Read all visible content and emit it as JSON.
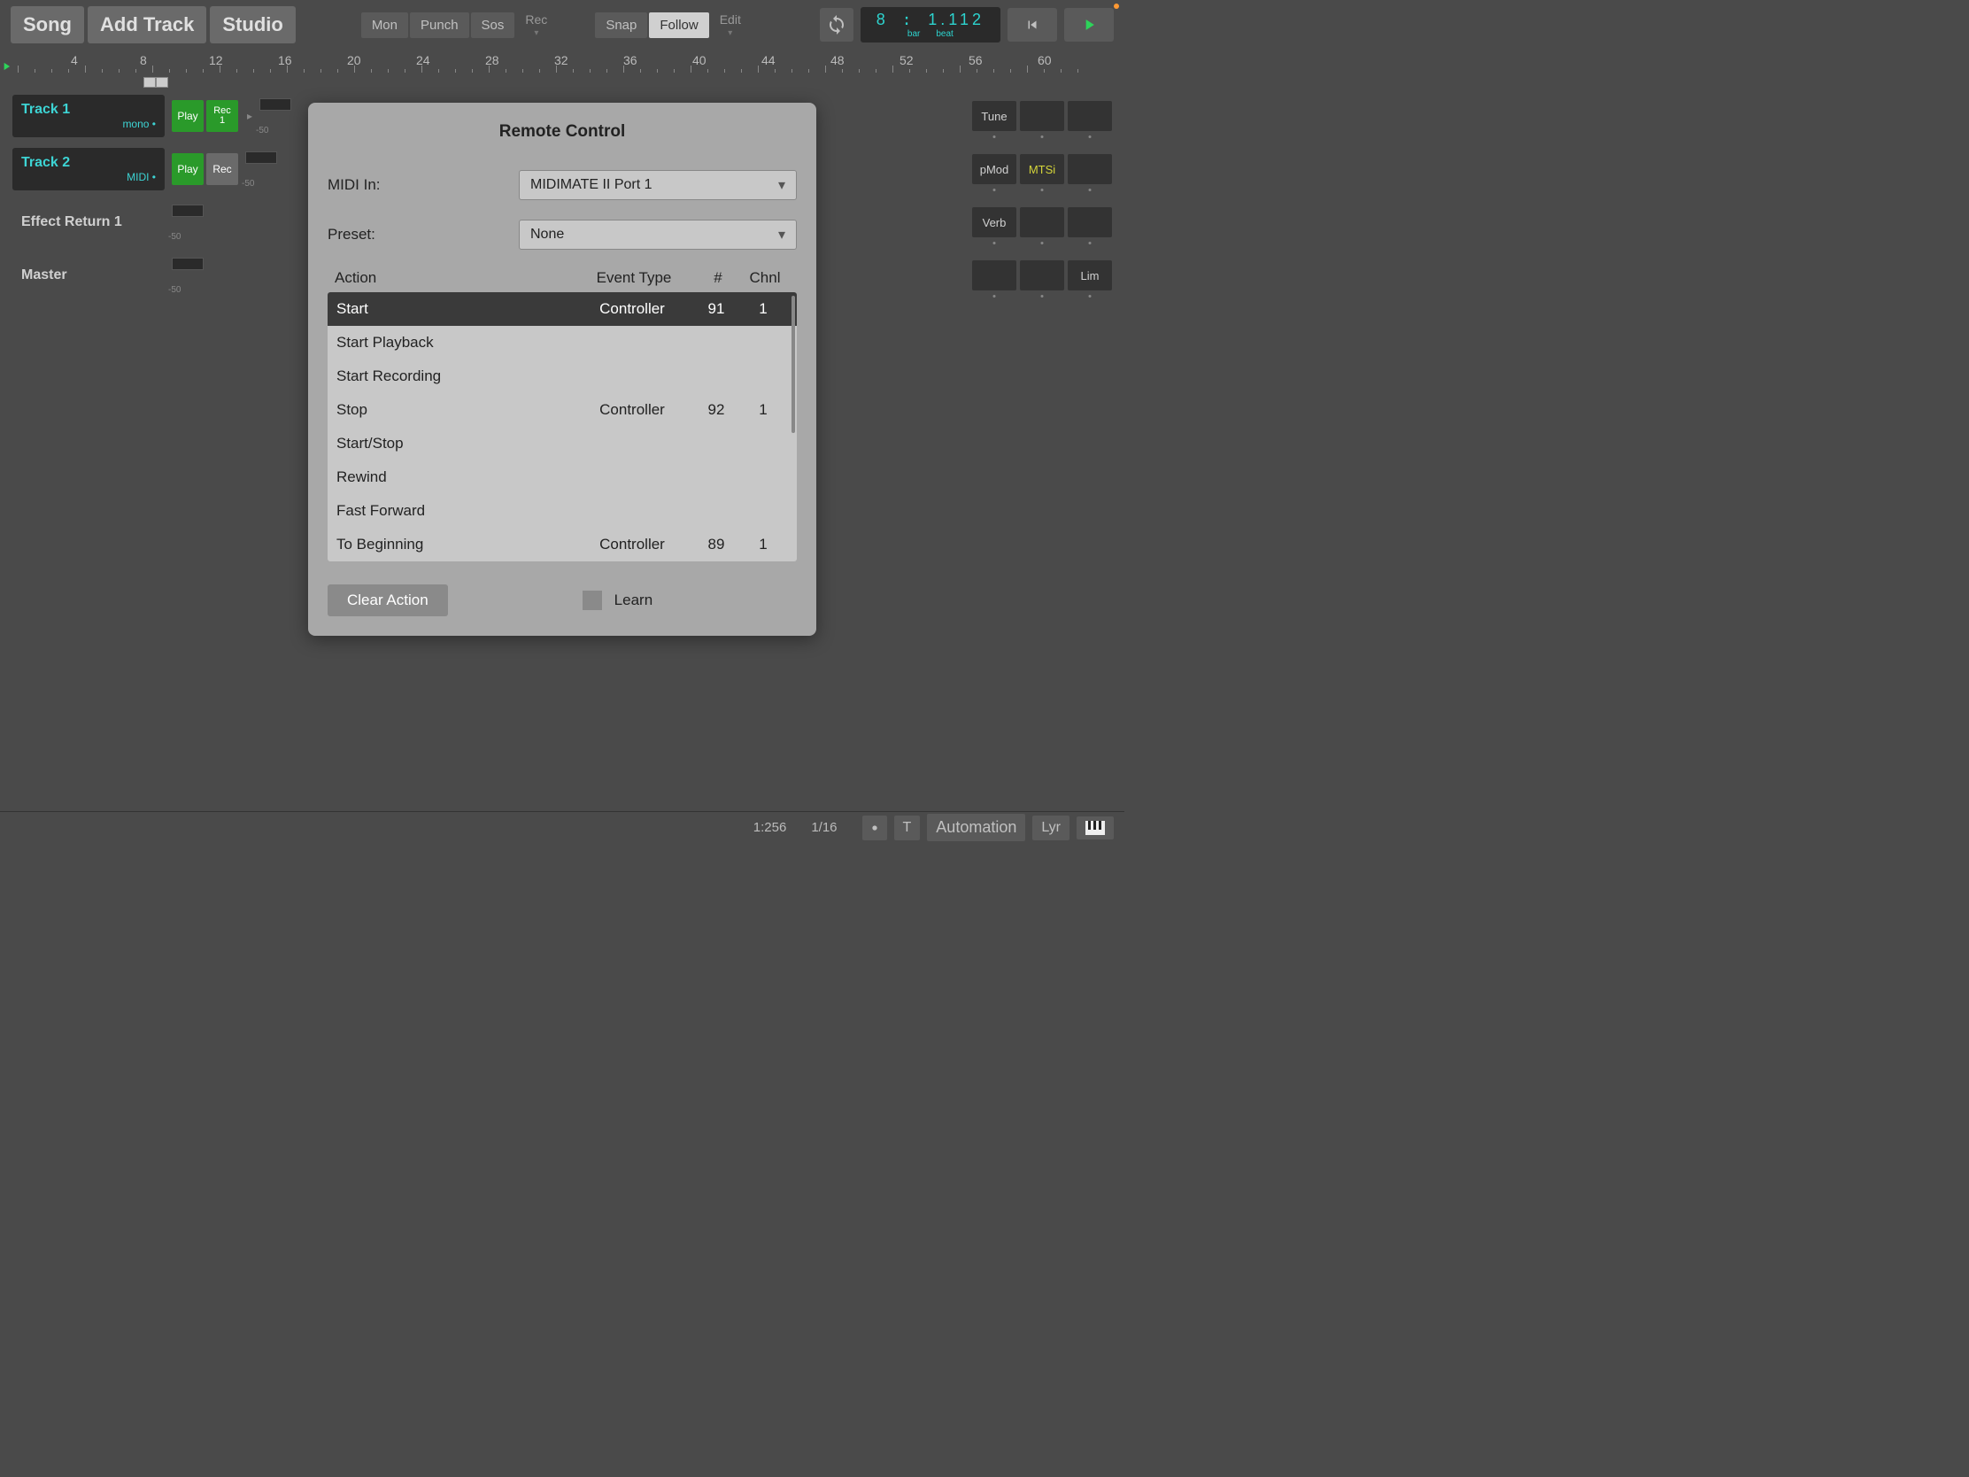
{
  "toolbar": {
    "song": "Song",
    "add_track": "Add Track",
    "studio": "Studio",
    "mon": "Mon",
    "punch": "Punch",
    "sos": "Sos",
    "rec": "Rec",
    "snap": "Snap",
    "follow": "Follow",
    "edit": "Edit"
  },
  "time": {
    "bar_value": "8",
    "beat_value": "1.112",
    "bar_label": "bar",
    "beat_label": "beat"
  },
  "ruler": {
    "numbers": [
      "4",
      "8",
      "12",
      "16",
      "20",
      "24",
      "28",
      "32",
      "36",
      "40",
      "44",
      "48",
      "52",
      "56",
      "60"
    ]
  },
  "tracks": [
    {
      "name": "Track 1",
      "sub": "mono •",
      "play": "Play",
      "rec": "Rec",
      "rec_num": "1",
      "rec_green": true,
      "meter": "-50",
      "slots": [
        {
          "txt": "Tune"
        },
        {
          "txt": ""
        },
        {
          "txt": ""
        }
      ],
      "header_plain": false
    },
    {
      "name": "Track 2",
      "sub": "MIDI •",
      "play": "Play",
      "rec": "Rec",
      "rec_num": "",
      "rec_green": false,
      "meter": "-50",
      "slots": [
        {
          "txt": "pMod"
        },
        {
          "txt": "MTSi",
          "active": true
        },
        {
          "txt": ""
        }
      ],
      "header_plain": false
    },
    {
      "name": "Effect Return 1",
      "sub": "",
      "play": "",
      "rec": "",
      "meter": "-50",
      "slots": [
        {
          "txt": "Verb"
        },
        {
          "txt": ""
        },
        {
          "txt": ""
        }
      ],
      "header_plain": true
    },
    {
      "name": "Master",
      "sub": "",
      "play": "",
      "rec": "",
      "meter": "-50",
      "slots": [
        {
          "txt": ""
        },
        {
          "txt": ""
        },
        {
          "txt": "Lim"
        }
      ],
      "header_plain": true
    }
  ],
  "modal": {
    "title": "Remote Control",
    "midi_in_label": "MIDI In:",
    "midi_in_value": "MIDIMATE II Port 1",
    "preset_label": "Preset:",
    "preset_value": "None",
    "col_action": "Action",
    "col_event": "Event Type",
    "col_num": "#",
    "col_chnl": "Chnl",
    "actions": [
      {
        "action": "Start",
        "event": "Controller",
        "num": "91",
        "chnl": "1",
        "selected": true
      },
      {
        "action": "Start Playback",
        "event": "",
        "num": "",
        "chnl": ""
      },
      {
        "action": "Start Recording",
        "event": "",
        "num": "",
        "chnl": ""
      },
      {
        "action": "Stop",
        "event": "Controller",
        "num": "92",
        "chnl": "1"
      },
      {
        "action": "Start/Stop",
        "event": "",
        "num": "",
        "chnl": ""
      },
      {
        "action": "Rewind",
        "event": "",
        "num": "",
        "chnl": ""
      },
      {
        "action": "Fast Forward",
        "event": "",
        "num": "",
        "chnl": ""
      },
      {
        "action": "To Beginning",
        "event": "Controller",
        "num": "89",
        "chnl": "1"
      }
    ],
    "clear_action": "Clear Action",
    "learn": "Learn"
  },
  "bottom": {
    "zoom": "1:256",
    "grid": "1/16",
    "t": "T",
    "automation": "Automation",
    "lyr": "Lyr"
  }
}
